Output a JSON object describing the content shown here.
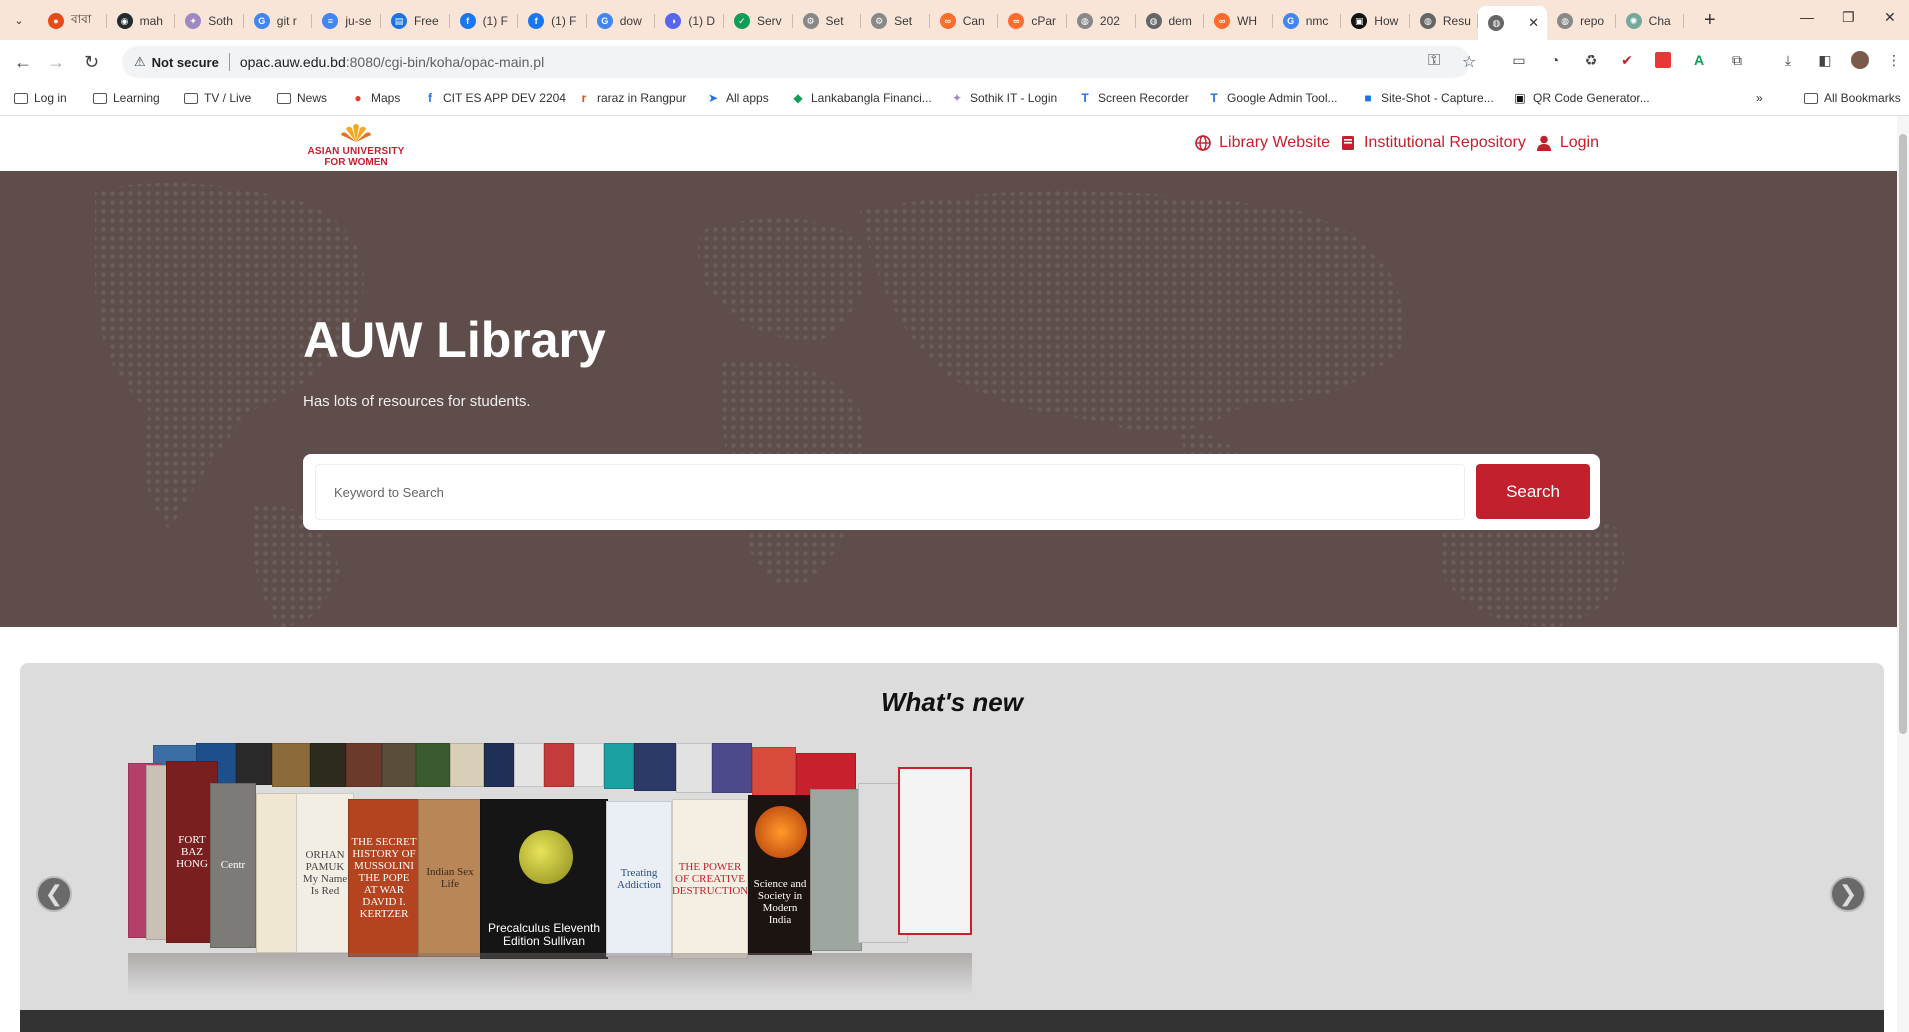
{
  "browser": {
    "tabs": [
      {
        "title": "বাবা",
        "color": "#e64a19",
        "glyph": "●"
      },
      {
        "title": "mah",
        "color": "#24292f",
        "glyph": "◉"
      },
      {
        "title": "Soth",
        "color": "#9e8ac0",
        "glyph": "✦"
      },
      {
        "title": "git r",
        "color": "#4285f4",
        "glyph": "G"
      },
      {
        "title": "ju-se",
        "color": "#4285f4",
        "glyph": "≡"
      },
      {
        "title": "Free",
        "color": "#1a73e8",
        "glyph": "▤"
      },
      {
        "title": "(1) F",
        "color": "#1877f2",
        "glyph": "f"
      },
      {
        "title": "(1) F",
        "color": "#1877f2",
        "glyph": "f"
      },
      {
        "title": "dow",
        "color": "#4285f4",
        "glyph": "G"
      },
      {
        "title": "(1) D",
        "color": "#5865f2",
        "glyph": "◑"
      },
      {
        "title": "Serv",
        "color": "#0f9d58",
        "glyph": "✓"
      },
      {
        "title": "Set",
        "color": "#888888",
        "glyph": "⚙"
      },
      {
        "title": "Set",
        "color": "#888888",
        "glyph": "⚙"
      },
      {
        "title": "Can",
        "color": "#ff6c2c",
        "glyph": "∞"
      },
      {
        "title": "cPar",
        "color": "#ff6c2c",
        "glyph": "∞"
      },
      {
        "title": "202",
        "color": "#888888",
        "glyph": "◍"
      },
      {
        "title": "dem",
        "color": "#666666",
        "glyph": "◍"
      },
      {
        "title": "WH",
        "color": "#ff6c2c",
        "glyph": "∞"
      },
      {
        "title": "nmc",
        "color": "#4285f4",
        "glyph": "G"
      },
      {
        "title": "How",
        "color": "#111111",
        "glyph": "▣"
      },
      {
        "title": "Resu",
        "color": "#666666",
        "glyph": "◍"
      },
      {
        "title": "",
        "color": "#666666",
        "glyph": "◍",
        "active": true
      },
      {
        "title": "repo",
        "color": "#888888",
        "glyph": "◍"
      },
      {
        "title": "Cha",
        "color": "#74aa9c",
        "glyph": "✺"
      }
    ],
    "security_label": "Not secure",
    "url_host": "opac.auw.edu.bd",
    "url_rest": ":8080/cgi-bin/koha/opac-main.pl",
    "bookmarks": [
      {
        "label": "Log in",
        "icon": "folder"
      },
      {
        "label": "Learning",
        "icon": "folder"
      },
      {
        "label": "TV / Live",
        "icon": "folder"
      },
      {
        "label": "News",
        "icon": "folder"
      },
      {
        "label": "Maps",
        "icon": "pin"
      },
      {
        "label": "CIT ES APP DEV 2204",
        "icon": "fb"
      },
      {
        "label": "raraz in Rangpur",
        "icon": "r"
      },
      {
        "label": "All apps",
        "icon": "arrow"
      },
      {
        "label": "Lankabangla Financi...",
        "icon": "lb"
      },
      {
        "label": "Sothik IT - Login",
        "icon": "so"
      },
      {
        "label": "Screen Recorder",
        "icon": "t"
      },
      {
        "label": "Google Admin Tool...",
        "icon": "t"
      },
      {
        "label": "Site-Shot - Capture...",
        "icon": "cam"
      },
      {
        "label": "QR Code Generator...",
        "icon": "qr"
      }
    ],
    "all_bookmarks_label": "All Bookmarks"
  },
  "site": {
    "logo_line1": "ASIAN UNIVERSITY",
    "logo_line2": "FOR WOMEN",
    "nav": {
      "library_website": "Library Website",
      "institutional_repository": "Institutional Repository",
      "login": "Login"
    },
    "accent_color": "#c1202c",
    "hero": {
      "title": "AUW Library",
      "subtitle": "Has lots of resources for students.",
      "search_placeholder": "Keyword to Search",
      "search_button": "Search",
      "background_color": "#5e4d4a"
    },
    "whats_new": {
      "title": "What's new",
      "prev_glyph": "❮",
      "next_glyph": "❯",
      "covers": [
        "THE SECRET HISTORY OF MUSSOLINI THE POPE AT WAR DAVID I. KERTZER",
        "Indian Sex Life",
        "Precalculus Eleventh Edition Sullivan",
        "THE POWER OF CREATIVE DESTRUCTION",
        "Treating Addiction",
        "Science and Society in Modern India",
        "ORHAN PAMUK My Name Is Red"
      ]
    }
  }
}
